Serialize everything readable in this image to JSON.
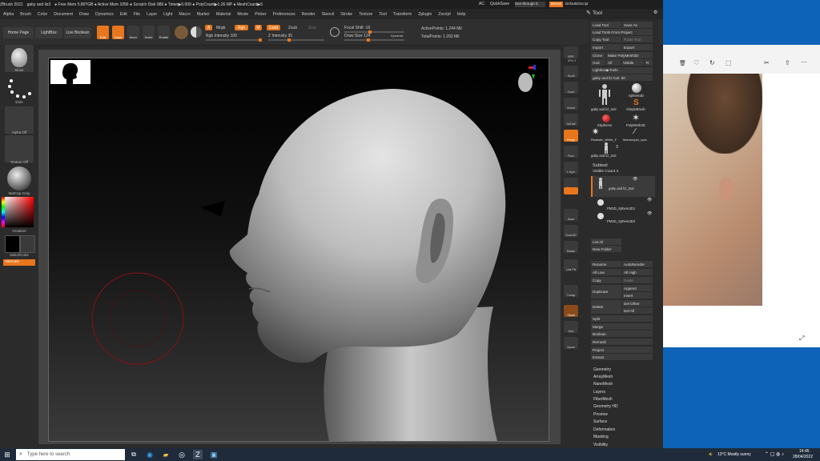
{
  "titlebar": {
    "items": [
      "ZBrush 2021",
      "gaby and liz3",
      "● Free Mem 5.80?GB ● Active Mem 1056 ● Scratch Disk 989 ● Timer▶0.009 ● PolyCount▶1.26 MP ● MeshCount▶5"
    ],
    "right": [
      "AC",
      "QuickSave",
      "See-through 0",
      "Menus",
      "DefaultZScript"
    ]
  },
  "menubar": [
    "Alpha",
    "Brush",
    "Color",
    "Document",
    "Draw",
    "Dynamics",
    "Edit",
    "File",
    "Layer",
    "Light",
    "Macro",
    "Marker",
    "Material",
    "Movie",
    "Picker",
    "Preferences",
    "Render",
    "Stencil",
    "Stroke",
    "Texture",
    "Tool",
    "Transform",
    "Zplugin",
    "Zscript",
    "Help"
  ],
  "toolbar": {
    "home_page": "Home Page",
    "lightbox": "LightBox",
    "live_boolean": "Live Boolean",
    "edit": "Edit",
    "draw": "Draw",
    "move": "Move",
    "scale": "Scale",
    "rotate": "Rotate",
    "a": "A",
    "mrgb": "Mrgb",
    "rgb": "Rgb",
    "m": "M",
    "zadd": "Zadd",
    "zsub": "Zsub",
    "zcut": "Zcut",
    "rgb_intensity": "Rgb Intensity 100",
    "z_intensity": "Z Intensity 35",
    "focal_shift": "Focal Shift -16",
    "draw_size": "Draw Size 124",
    "dynamic": "Dynamic",
    "active_points": "ActivePoints: 1.244 Mil",
    "total_points": "TotalPoints: 1.292 Mil"
  },
  "leftpanel": {
    "brush": "Move",
    "stroke": "Dots",
    "alpha": "Alpha Off",
    "texture": "Texture Off",
    "material": "MatCap Gray",
    "gradient": "Gradient",
    "switch_color": "SwitchColor",
    "alternate": "Alternate"
  },
  "rightshelf": [
    "BPR",
    "SPix 3",
    "Scroll",
    "Zoom",
    "Actual",
    "AAHalf",
    "Persp",
    "Floor",
    "L.Sym",
    "Frame",
    "Move",
    "Zoom3D",
    "Rotate",
    "Line Fill",
    "PolyF",
    "Transp",
    "Ghost",
    "Solo",
    "Xpose"
  ],
  "tray": {
    "title": "Tool",
    "load_tool": "Load Tool",
    "save_as": "Save As",
    "load_from_project": "Load Tools From Project",
    "copy_tool": "Copy Tool",
    "paste_tool": "Paste Tool",
    "import": "Import",
    "export": "Export",
    "clone": "Clone",
    "make_polymesh": "Make PolyMesh3D",
    "goz": "GoZ",
    "all": "All",
    "visible": "Visible",
    "r": "R",
    "lightbox_tools": "Lightbox▶Tools",
    "current_tool": "gaby and liz tool. 50",
    "tool_items": [
      "gaby and liz_tool",
      "Sphere3D",
      "SimpleBrush",
      "ZSpheres",
      "PolyMesh3D",
      "Realistic_White_F",
      "Mannequin_ryan",
      "gaby and liz_tool"
    ],
    "tool_count": "3",
    "subtool": "Subtool",
    "visible_count": "Visible Count 4",
    "subtools": [
      "gaby and liz_tool",
      "PM3D_Sphere3D1",
      "PM3D_Sphere3D2"
    ],
    "list_all": "List All",
    "new_folder": "New Folder",
    "rename": "Rename",
    "autoreorder": "AutoReorder",
    "all_low": "All Low",
    "all_high": "All High",
    "copy": "Copy",
    "paste": "Paste",
    "duplicate": "Duplicate",
    "append": "Append",
    "insert": "Insert",
    "delete": "Delete",
    "del_other": "Del Other",
    "del_all": "Del All",
    "split": "Split",
    "merge": "Merge",
    "boolean": "Boolean",
    "remesh": "Remesh",
    "project": "Project",
    "extract": "Extract",
    "menus": [
      "Geometry",
      "ArrayMesh",
      "NanoMesh",
      "Layers",
      "FiberMesh",
      "Geometry HD",
      "Preview",
      "Surface",
      "Deformation",
      "Masking",
      "Visibility"
    ]
  },
  "taskbar": {
    "search_placeholder": "Type here to search",
    "weather": "13°C  Mostly sunny",
    "time": "14:45",
    "date": "28/04/2022"
  }
}
